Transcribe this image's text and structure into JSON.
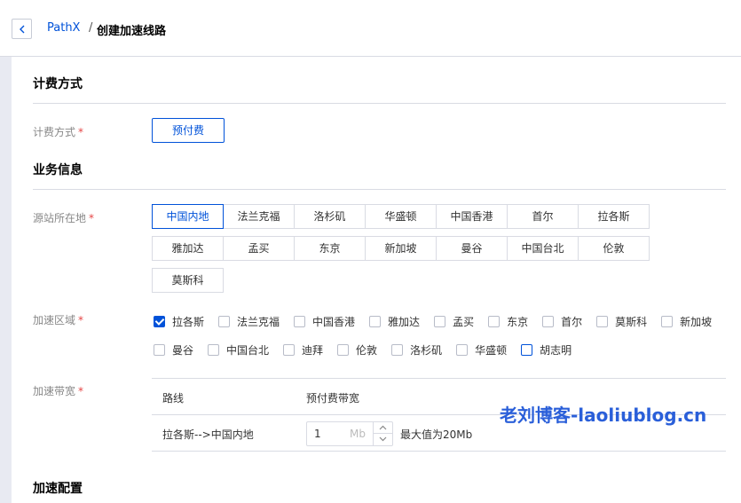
{
  "header": {
    "back_icon": "chevron-left-icon",
    "breadcrumb_link": "PathX",
    "breadcrumb_sep": "/",
    "breadcrumb_current": "创建加速线路"
  },
  "billing_section": {
    "title": "计费方式",
    "label": "计费方式",
    "required": "*",
    "option": "预付费"
  },
  "business_section": {
    "title": "业务信息",
    "origin": {
      "label": "源站所在地",
      "required": "*",
      "rows": [
        [
          "中国内地",
          "法兰克福",
          "洛杉矶",
          "华盛顿",
          "中国香港",
          "首尔",
          "拉各斯"
        ],
        [
          "雅加达",
          "孟买",
          "东京",
          "新加坡",
          "曼谷",
          "中国台北",
          "伦敦"
        ],
        [
          "莫斯科"
        ]
      ],
      "selected": "中国内地"
    },
    "accel_region": {
      "label": "加速区域",
      "required": "*",
      "rows": [
        [
          "拉各斯",
          "法兰克福",
          "中国香港",
          "雅加达",
          "孟买",
          "东京",
          "首尔",
          "莫斯科",
          "新加坡"
        ],
        [
          "曼谷",
          "中国台北",
          "迪拜",
          "伦敦",
          "洛杉矶",
          "华盛顿",
          "胡志明"
        ]
      ],
      "checked": [
        "拉各斯"
      ]
    },
    "bandwidth": {
      "label": "加速带宽",
      "required": "*",
      "col_route": "路线",
      "col_bw": "预付费带宽",
      "route": "拉各斯-->中国内地",
      "value": "1",
      "unit": "Mb",
      "hint": "最大值为20Mb"
    }
  },
  "config_section": {
    "title": "加速配置"
  },
  "watermark": "老刘博客-laoliublog.cn",
  "colors": {
    "accent": "#0052d9",
    "required": "#e54545",
    "border": "#d9dbe3"
  }
}
